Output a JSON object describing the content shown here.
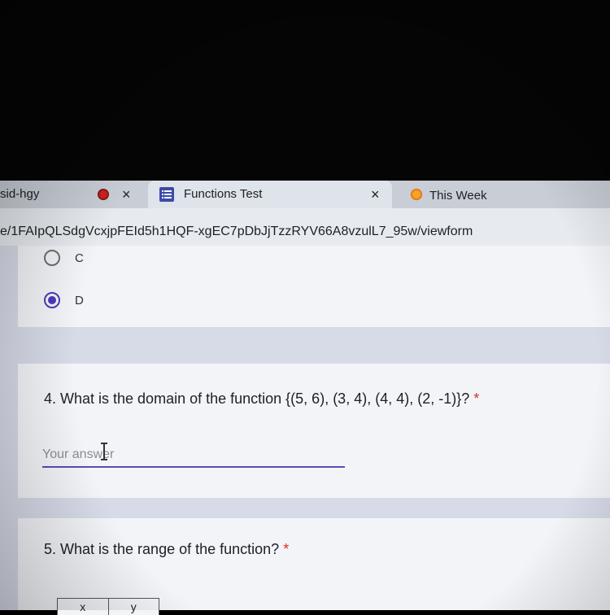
{
  "browser": {
    "tabs": [
      {
        "title": "sid-hgy",
        "close": "×",
        "icon": "record-icon"
      },
      {
        "title": "Functions Test",
        "close": "×",
        "icon": "google-forms-icon"
      },
      {
        "title": "This Week",
        "icon": "sun-icon"
      }
    ],
    "url": "e/1FAIpQLSdgVcxjpFEId5h1HQF-xgEC7pDbJjTzzRYV66A8vzulL7_95w/viewform"
  },
  "form": {
    "accent_color": "#4b3bb8",
    "previous_question": {
      "options": [
        {
          "label": "C",
          "selected": false
        },
        {
          "label": "D",
          "selected": true
        }
      ]
    },
    "question4": {
      "text": "4. What is the domain of the function {(5, 6), (3, 4), (4, 4), (2, -1)}?",
      "required_marker": "*",
      "answer_placeholder": "Your answer",
      "answer_value": ""
    },
    "question5": {
      "text": "5. What is the range of the function?",
      "required_marker": "*",
      "table_headers": [
        "x",
        "y"
      ]
    }
  }
}
